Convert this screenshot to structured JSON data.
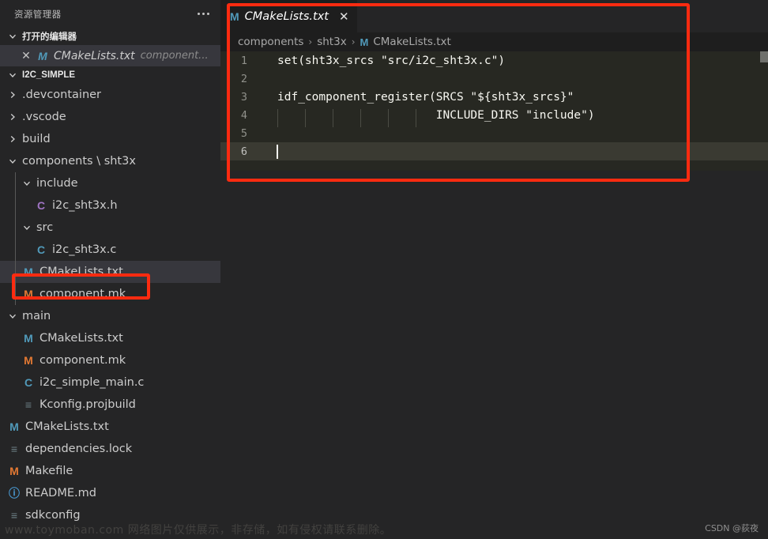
{
  "sidebar": {
    "title": "资源管理器",
    "more_label": "···",
    "open_editors": {
      "label": "打开的编辑器",
      "items": [
        {
          "close": "✕",
          "icon": "M",
          "icon_kind": "m",
          "label": "CMakeLists.txt",
          "desc": "component..."
        }
      ]
    },
    "project": {
      "label": "I2C_SIMPLE",
      "items": [
        {
          "indent": 8,
          "arrow": "right",
          "icon": null,
          "icon_kind": null,
          "label": ".devcontainer",
          "selected": false,
          "guide": false
        },
        {
          "indent": 8,
          "arrow": "right",
          "icon": null,
          "icon_kind": null,
          "label": ".vscode",
          "selected": false,
          "guide": false
        },
        {
          "indent": 8,
          "arrow": "right",
          "icon": null,
          "icon_kind": null,
          "label": "build",
          "selected": false,
          "guide": false
        },
        {
          "indent": 8,
          "arrow": "down",
          "icon": null,
          "icon_kind": null,
          "label": "components \\ sht3x",
          "selected": false,
          "guide": false
        },
        {
          "indent": 26,
          "arrow": "down",
          "icon": null,
          "icon_kind": null,
          "label": "include",
          "selected": false,
          "guide": true
        },
        {
          "indent": 42,
          "arrow": "none",
          "icon": "C",
          "icon_kind": "c-purple",
          "label": "i2c_sht3x.h",
          "selected": false,
          "guide": true
        },
        {
          "indent": 26,
          "arrow": "down",
          "icon": null,
          "icon_kind": null,
          "label": "src",
          "selected": false,
          "guide": true
        },
        {
          "indent": 42,
          "arrow": "none",
          "icon": "C",
          "icon_kind": "c-blue",
          "label": "i2c_sht3x.c",
          "selected": false,
          "guide": true
        },
        {
          "indent": 26,
          "arrow": "none",
          "icon": "M",
          "icon_kind": "m",
          "label": "CMakeLists.txt",
          "selected": true,
          "guide": true
        },
        {
          "indent": 26,
          "arrow": "none",
          "icon": "M",
          "icon_kind": "m-orange",
          "label": "component.mk",
          "selected": false,
          "guide": true
        },
        {
          "indent": 8,
          "arrow": "down",
          "icon": null,
          "icon_kind": null,
          "label": "main",
          "selected": false,
          "guide": false
        },
        {
          "indent": 26,
          "arrow": "none",
          "icon": "M",
          "icon_kind": "m",
          "label": "CMakeLists.txt",
          "selected": false,
          "guide": false
        },
        {
          "indent": 26,
          "arrow": "none",
          "icon": "M",
          "icon_kind": "m-orange",
          "label": "component.mk",
          "selected": false,
          "guide": false
        },
        {
          "indent": 26,
          "arrow": "none",
          "icon": "C",
          "icon_kind": "c-blue",
          "label": "i2c_simple_main.c",
          "selected": false,
          "guide": false
        },
        {
          "indent": 26,
          "arrow": "none",
          "icon": "≡",
          "icon_kind": "lines",
          "label": "Kconfig.projbuild",
          "selected": false,
          "guide": false
        },
        {
          "indent": 8,
          "arrow": "none",
          "icon": "M",
          "icon_kind": "m",
          "label": "CMakeLists.txt",
          "selected": false,
          "guide": false
        },
        {
          "indent": 8,
          "arrow": "none",
          "icon": "≡",
          "icon_kind": "lines",
          "label": "dependencies.lock",
          "selected": false,
          "guide": false
        },
        {
          "indent": 8,
          "arrow": "none",
          "icon": "M",
          "icon_kind": "m-orange",
          "label": "Makefile",
          "selected": false,
          "guide": false
        },
        {
          "indent": 8,
          "arrow": "none",
          "icon": "ⓘ",
          "icon_kind": "info",
          "label": "README.md",
          "selected": false,
          "guide": false
        },
        {
          "indent": 8,
          "arrow": "none",
          "icon": "≡",
          "icon_kind": "lines",
          "label": "sdkconfig",
          "selected": false,
          "guide": false
        }
      ]
    }
  },
  "editor": {
    "tab": {
      "icon": "M",
      "label": "CMakeLists.txt",
      "close": "✕"
    },
    "breadcrumb": {
      "segments": [
        "components",
        "sht3x"
      ],
      "separator": "›",
      "file_icon": "M",
      "file": "CMakeLists.txt"
    },
    "lines": [
      {
        "num": "1",
        "text": "set(sht3x_srcs \"src/i2c_sht3x.c\")",
        "current": false,
        "guides": 0
      },
      {
        "num": "2",
        "text": "",
        "current": false,
        "guides": 0
      },
      {
        "num": "3",
        "text": "idf_component_register(SRCS \"${sht3x_srcs}\"",
        "current": false,
        "guides": 0
      },
      {
        "num": "4",
        "text": "                       INCLUDE_DIRS \"include\")",
        "current": false,
        "guides": 6
      },
      {
        "num": "5",
        "text": "",
        "current": false,
        "guides": 0
      },
      {
        "num": "6",
        "text": "",
        "current": true,
        "guides": 0
      }
    ]
  },
  "annotations": {
    "editor_box_color": "#fe2b10",
    "sidebar_box_color": "#fe2b10"
  },
  "watermarks": {
    "csdn": "CSDN @荻夜",
    "faint": "www.toymoban.com 网络图片仅供展示，非存储，如有侵权请联系删除。"
  }
}
